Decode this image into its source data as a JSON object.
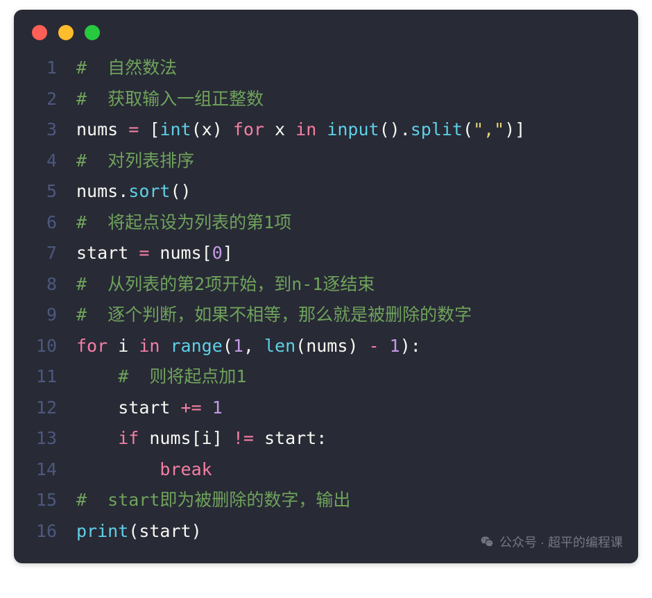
{
  "window": {
    "dots": [
      "red",
      "yellow",
      "green"
    ]
  },
  "watermark": {
    "text": "公众号 · 超平的编程课"
  },
  "code": {
    "lines": [
      {
        "n": "1",
        "tokens": [
          {
            "cls": "c-comment",
            "t": "#  自然数法"
          }
        ]
      },
      {
        "n": "2",
        "tokens": [
          {
            "cls": "c-comment",
            "t": "#  获取输入一组正整数"
          }
        ]
      },
      {
        "n": "3",
        "tokens": [
          {
            "cls": "c-ident",
            "t": "nums "
          },
          {
            "cls": "c-op",
            "t": "="
          },
          {
            "cls": "c-text",
            "t": " ["
          },
          {
            "cls": "c-func",
            "t": "int"
          },
          {
            "cls": "c-paren",
            "t": "("
          },
          {
            "cls": "c-ident",
            "t": "x"
          },
          {
            "cls": "c-paren",
            "t": ") "
          },
          {
            "cls": "c-kw",
            "t": "for"
          },
          {
            "cls": "c-ident",
            "t": " x "
          },
          {
            "cls": "c-kw",
            "t": "in"
          },
          {
            "cls": "c-text",
            "t": " "
          },
          {
            "cls": "c-func",
            "t": "input"
          },
          {
            "cls": "c-paren",
            "t": "()"
          },
          {
            "cls": "c-text",
            "t": "."
          },
          {
            "cls": "c-func",
            "t": "split"
          },
          {
            "cls": "c-paren",
            "t": "("
          },
          {
            "cls": "c-str",
            "t": "\",\""
          },
          {
            "cls": "c-paren",
            "t": ")]"
          }
        ]
      },
      {
        "n": "4",
        "tokens": [
          {
            "cls": "c-comment",
            "t": "#  对列表排序"
          }
        ]
      },
      {
        "n": "5",
        "tokens": [
          {
            "cls": "c-ident",
            "t": "nums"
          },
          {
            "cls": "c-text",
            "t": "."
          },
          {
            "cls": "c-func",
            "t": "sort"
          },
          {
            "cls": "c-paren",
            "t": "()"
          }
        ]
      },
      {
        "n": "6",
        "tokens": [
          {
            "cls": "c-comment",
            "t": "#  将起点设为列表的第1项"
          }
        ]
      },
      {
        "n": "7",
        "tokens": [
          {
            "cls": "c-ident",
            "t": "start "
          },
          {
            "cls": "c-op",
            "t": "="
          },
          {
            "cls": "c-ident",
            "t": " nums"
          },
          {
            "cls": "c-paren",
            "t": "["
          },
          {
            "cls": "c-num",
            "t": "0"
          },
          {
            "cls": "c-paren",
            "t": "]"
          }
        ]
      },
      {
        "n": "8",
        "tokens": [
          {
            "cls": "c-comment",
            "t": "#  从列表的第2项开始，到n-1逐结束"
          }
        ]
      },
      {
        "n": "9",
        "tokens": [
          {
            "cls": "c-comment",
            "t": "#  逐个判断，如果不相等，那么就是被删除的数字"
          }
        ]
      },
      {
        "n": "10",
        "tokens": [
          {
            "cls": "c-kw",
            "t": "for"
          },
          {
            "cls": "c-ident",
            "t": " i "
          },
          {
            "cls": "c-kw",
            "t": "in"
          },
          {
            "cls": "c-text",
            "t": " "
          },
          {
            "cls": "c-func",
            "t": "range"
          },
          {
            "cls": "c-paren",
            "t": "("
          },
          {
            "cls": "c-num",
            "t": "1"
          },
          {
            "cls": "c-text",
            "t": ", "
          },
          {
            "cls": "c-func",
            "t": "len"
          },
          {
            "cls": "c-paren",
            "t": "("
          },
          {
            "cls": "c-ident",
            "t": "nums"
          },
          {
            "cls": "c-paren",
            "t": ")"
          },
          {
            "cls": "c-text",
            "t": " "
          },
          {
            "cls": "c-op",
            "t": "-"
          },
          {
            "cls": "c-text",
            "t": " "
          },
          {
            "cls": "c-num",
            "t": "1"
          },
          {
            "cls": "c-paren",
            "t": "):"
          }
        ]
      },
      {
        "n": "11",
        "tokens": [
          {
            "cls": "c-text",
            "t": "    "
          },
          {
            "cls": "c-comment",
            "t": "#  则将起点加1"
          }
        ]
      },
      {
        "n": "12",
        "tokens": [
          {
            "cls": "c-text",
            "t": "    "
          },
          {
            "cls": "c-ident",
            "t": "start "
          },
          {
            "cls": "c-op",
            "t": "+="
          },
          {
            "cls": "c-text",
            "t": " "
          },
          {
            "cls": "c-num",
            "t": "1"
          }
        ]
      },
      {
        "n": "13",
        "tokens": [
          {
            "cls": "c-text",
            "t": "    "
          },
          {
            "cls": "c-kw",
            "t": "if"
          },
          {
            "cls": "c-ident",
            "t": " nums"
          },
          {
            "cls": "c-paren",
            "t": "["
          },
          {
            "cls": "c-ident",
            "t": "i"
          },
          {
            "cls": "c-paren",
            "t": "] "
          },
          {
            "cls": "c-op",
            "t": "!="
          },
          {
            "cls": "c-ident",
            "t": " start"
          },
          {
            "cls": "c-paren",
            "t": ":"
          }
        ]
      },
      {
        "n": "14",
        "tokens": [
          {
            "cls": "c-text",
            "t": "        "
          },
          {
            "cls": "c-kw",
            "t": "break"
          }
        ]
      },
      {
        "n": "15",
        "tokens": [
          {
            "cls": "c-comment",
            "t": "#  start即为被删除的数字，输出"
          }
        ]
      },
      {
        "n": "16",
        "tokens": [
          {
            "cls": "c-func",
            "t": "print"
          },
          {
            "cls": "c-paren",
            "t": "("
          },
          {
            "cls": "c-ident",
            "t": "start"
          },
          {
            "cls": "c-paren",
            "t": ")"
          }
        ]
      }
    ]
  }
}
